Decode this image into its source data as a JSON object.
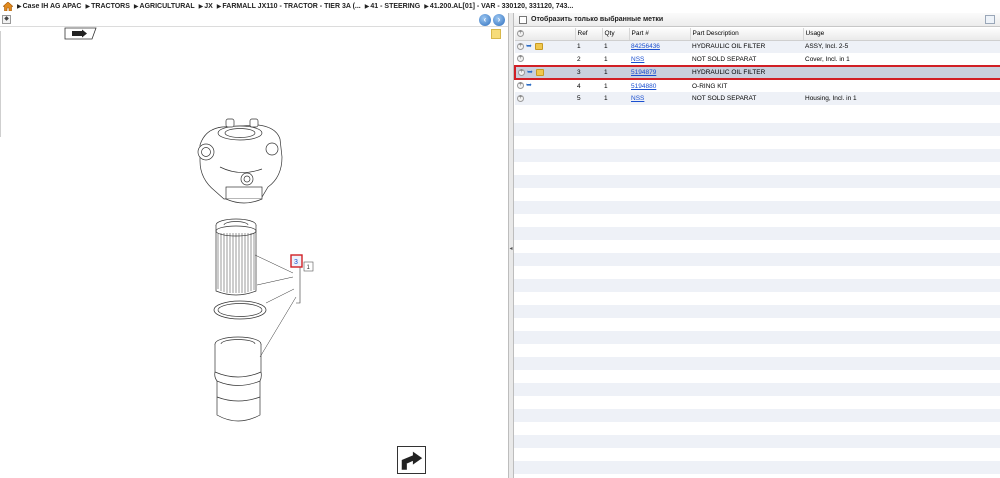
{
  "breadcrumb": {
    "home_icon": "home-icon",
    "items": [
      "Case IH AG APAC",
      "TRACTORS",
      "AGRICULTURAL",
      "JX",
      "FARMALL JX110 - TRACTOR - TIER 3A (...",
      "41 - STEERING",
      "41.200.AL[01] - VAR - 330120, 331120, 743..."
    ]
  },
  "left_toolbar": {
    "pin_label": "◆",
    "prev_label": "‹",
    "next_label": "›"
  },
  "drawing": {
    "callout_ref": "3",
    "callout_ref_tag": "1"
  },
  "filter": {
    "label": "Отобразить только выбранные метки",
    "checked": false
  },
  "parts_table": {
    "columns": [
      "",
      "Ref",
      "Qty",
      "Part #",
      "Part Description",
      "Usage"
    ],
    "rows": [
      {
        "icons": [
          "plus",
          "tool",
          "box"
        ],
        "ref": "1",
        "qty": "1",
        "part": "84256436",
        "desc": "HYDRAULIC OIL FILTER",
        "usage": "ASSY, Incl. 2-5",
        "selected": false
      },
      {
        "icons": [
          "plus"
        ],
        "ref": "2",
        "qty": "1",
        "part": "NSS",
        "desc": "NOT SOLD SEPARAT",
        "usage": "Cover, Incl. in 1",
        "selected": false
      },
      {
        "icons": [
          "plus",
          "tool",
          "box"
        ],
        "ref": "3",
        "qty": "1",
        "part": "5194879",
        "desc": "HYDRAULIC OIL FILTER",
        "usage": "",
        "selected": true
      },
      {
        "icons": [
          "plus",
          "tool"
        ],
        "ref": "4",
        "qty": "1",
        "part": "5194880",
        "desc": "O-RING KIT",
        "usage": "",
        "selected": false
      },
      {
        "icons": [
          "plus"
        ],
        "ref": "5",
        "qty": "1",
        "part": "NSS",
        "desc": "NOT SOLD SEPARAT",
        "usage": "Housing, Incl. in 1",
        "selected": false
      }
    ]
  },
  "colors": {
    "selection_border": "#d11f25",
    "link": "#1a4fd0",
    "row_alt": "#eef1f7"
  }
}
